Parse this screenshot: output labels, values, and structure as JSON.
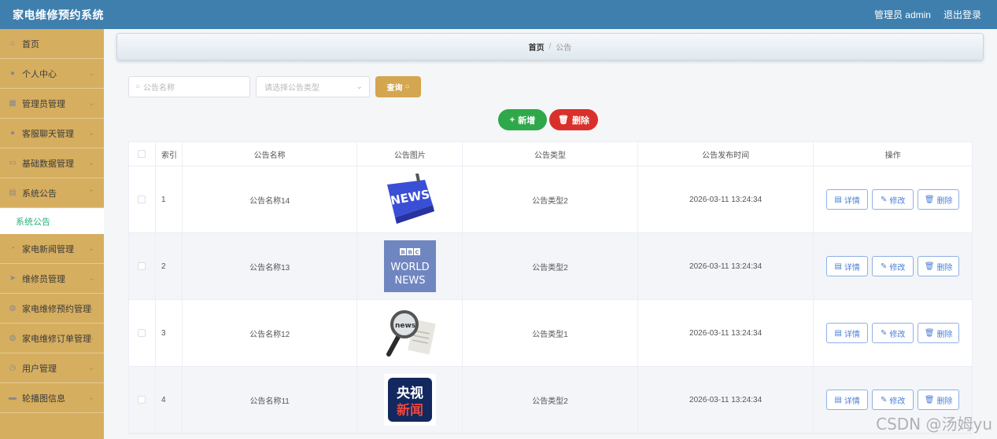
{
  "header": {
    "title": "家电维修预约系统",
    "user": "管理员 admin",
    "logout": "退出登录"
  },
  "sidebar": {
    "items": [
      {
        "label": "首页",
        "icon": "home-icon"
      },
      {
        "label": "个人中心",
        "icon": "user-icon"
      },
      {
        "label": "管理员管理",
        "icon": "admin-icon"
      },
      {
        "label": "客服聊天管理",
        "icon": "chat-icon"
      },
      {
        "label": "基础数据管理",
        "icon": "data-icon"
      },
      {
        "label": "系统公告",
        "icon": "notice-icon"
      },
      {
        "label": "家电新闻管理",
        "icon": "news-icon"
      },
      {
        "label": "维修员管理",
        "icon": "repairman-icon"
      },
      {
        "label": "家电维修预约管理",
        "icon": "appointment-icon"
      },
      {
        "label": "家电维修订单管理",
        "icon": "order-icon"
      },
      {
        "label": "用户管理",
        "icon": "users-icon"
      },
      {
        "label": "轮播图信息",
        "icon": "carousel-icon"
      }
    ],
    "sub_active": "系统公告"
  },
  "breadcrumb": {
    "home": "首页",
    "sep": "/",
    "current": "公告"
  },
  "search": {
    "name_placeholder": "公告名称",
    "type_placeholder": "请选择公告类型",
    "query_label": "查询"
  },
  "actions": {
    "add_label": "新增",
    "delete_label": "删除"
  },
  "table": {
    "headers": {
      "index": "索引",
      "name": "公告名称",
      "image": "公告图片",
      "type": "公告类型",
      "time": "公告发布时间",
      "ops": "操作"
    },
    "op_labels": {
      "detail": "详情",
      "edit": "修改",
      "delete": "删除"
    },
    "rows": [
      {
        "index": "1",
        "name": "公告名称14",
        "type": "公告类型2",
        "time": "2026-03-11 13:24:34",
        "image": "news-key-image"
      },
      {
        "index": "2",
        "name": "公告名称13",
        "type": "公告类型2",
        "time": "2026-03-11 13:24:34",
        "image": "bbc-world-news-image"
      },
      {
        "index": "3",
        "name": "公告名称12",
        "type": "公告类型1",
        "time": "2026-03-11 13:24:34",
        "image": "magnifier-news-image"
      },
      {
        "index": "4",
        "name": "公告名称11",
        "type": "公告类型2",
        "time": "2026-03-11 13:24:34",
        "image": "cctv-news-image"
      }
    ]
  },
  "image_text": {
    "news_key": "NEWS",
    "bbc_letters": [
      "B",
      "B",
      "C"
    ],
    "bbc_line1": "WORLD",
    "bbc_line2": "NEWS",
    "magnifier": "news",
    "cctv_line1": "央视",
    "cctv_line2": "新闻"
  },
  "watermark": "CSDN @汤姆yu",
  "colors": {
    "topbar": "#3f7fae",
    "sidebar": "#d6ae5f",
    "active_text": "#2bb07a",
    "add": "#2fa84a",
    "delete": "#d9302c",
    "query": "#d3a64f",
    "op_border": "#8fb0e6"
  }
}
